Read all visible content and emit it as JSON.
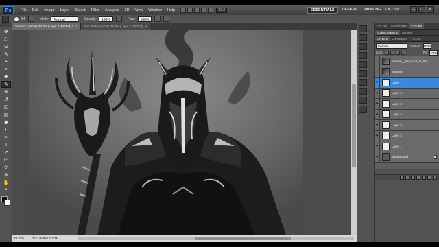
{
  "app": {
    "logo": "Ps",
    "menu": [
      "File",
      "Edit",
      "Image",
      "Layer",
      "Select",
      "Filter",
      "Analysis",
      "3D",
      "View",
      "Window",
      "Help"
    ],
    "zoom_dropdown": "33.3",
    "workspaces": [
      "ESSENTIALS",
      "DESIGN",
      "PAINTING"
    ],
    "workspace_more": "»",
    "cs_live": "CS Live",
    "window_buttons": [
      "–",
      "□",
      "×"
    ]
  },
  "options_bar": {
    "brush_size": "34",
    "mode_label": "Mode:",
    "mode_value": "Normal",
    "opacity_label": "Opacity:",
    "opacity_value": "100%",
    "flow_label": "Flow:",
    "flow_value": "100%"
  },
  "tabs": [
    {
      "label": "Sauron 2.psd @ 33.3% (Layer 7, RGB/8) *",
      "active": true
    },
    {
      "label": "Sam sketch.psd @ 33.3% (Layer 1, RGB/8)",
      "active": false
    }
  ],
  "tab_close": "×",
  "status_bar": {
    "zoom": "33.33%",
    "doc": "Doc: 46.8M/242.7M"
  },
  "panels": {
    "top_tabs": [
      "COLOR",
      "SWATCHES",
      "STYLES"
    ],
    "mid_tabs": [
      "ADJUSTMENTS",
      "MASKS"
    ],
    "layer_tabs": [
      "LAYERS",
      "CHANNELS",
      "PATHS"
    ],
    "blend_mode": "Normal",
    "opacity_label": "Opacity:",
    "opacity_value": "100%",
    "lock_label": "Lock:",
    "fill_label": "Fill:",
    "fill_value": "100%",
    "layers": [
      {
        "name": "Sauron__the_Lord_of_the...",
        "visible": false,
        "thumb": "img",
        "selected": false,
        "locked": false
      },
      {
        "name": "Sauron4",
        "visible": false,
        "thumb": "img",
        "selected": false,
        "locked": false
      },
      {
        "name": "Layer 7",
        "visible": true,
        "thumb": "trans",
        "selected": true,
        "locked": false
      },
      {
        "name": "Layer 6",
        "visible": true,
        "thumb": "trans",
        "selected": false,
        "locked": false
      },
      {
        "name": "Layer 5",
        "visible": true,
        "thumb": "trans",
        "selected": false,
        "locked": false
      },
      {
        "name": "Layer 4",
        "visible": true,
        "thumb": "trans",
        "selected": false,
        "locked": false
      },
      {
        "name": "Layer 3",
        "visible": true,
        "thumb": "trans",
        "selected": false,
        "locked": false
      },
      {
        "name": "Layer 2",
        "visible": true,
        "thumb": "trans",
        "selected": false,
        "locked": false
      },
      {
        "name": "Layer 1",
        "visible": true,
        "thumb": "trans",
        "selected": false,
        "locked": false
      },
      {
        "name": "Background",
        "visible": true,
        "thumb": "bg",
        "selected": false,
        "locked": true
      }
    ]
  },
  "tools": [
    "move-icon",
    "marquee-icon",
    "lasso-icon",
    "quick-select-icon",
    "crop-icon",
    "eyedropper-icon",
    "healing-icon",
    "brush-icon",
    "clone-stamp-icon",
    "history-brush-icon",
    "eraser-icon",
    "gradient-icon",
    "blur-icon",
    "dodge-icon",
    "pen-icon",
    "type-icon",
    "path-select-icon",
    "shape-icon",
    "3d-rotate-icon",
    "3d-orbit-icon",
    "hand-icon",
    "zoom-icon"
  ],
  "tool_glyphs": [
    "✥",
    "⬚",
    "ʘ",
    "✎",
    "⌗",
    "✒",
    "✚",
    "✎",
    "⊕",
    "↺",
    "◫",
    "▤",
    "◆",
    "◐",
    "✑",
    "T",
    "➚",
    "▭",
    "⟳",
    "⊛",
    "✋",
    "⌕"
  ],
  "colors": {
    "selected_layer": "#3a87e0",
    "ui_gray": "#535353"
  }
}
